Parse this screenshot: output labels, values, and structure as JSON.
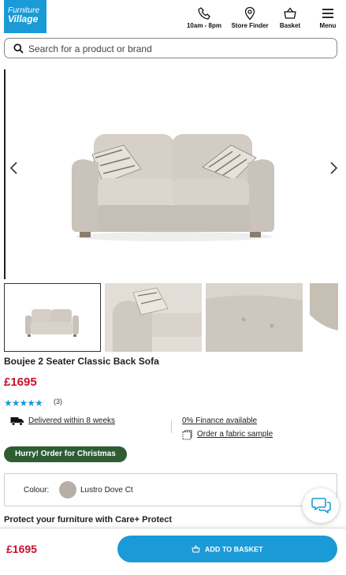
{
  "header": {
    "logo_line1": "Furniture",
    "logo_line2": "Village",
    "phone_label": "10am - 8pm",
    "store_label": "Store Finder",
    "basket_label": "Basket",
    "menu_label": "Menu"
  },
  "search": {
    "placeholder": "Search for a product or brand",
    "value": ""
  },
  "product": {
    "title": "Boujee 2 Seater Classic Back Sofa",
    "price": "£1695",
    "rating": 5,
    "stars": "★★★★★",
    "review_count": "(3)",
    "delivery": "Delivered within 8 weeks",
    "finance": "0% Finance available",
    "fabric_sample": "Order a fabric sample",
    "badge": "Hurry! Order for Christmas",
    "colour_label": "Colour:",
    "colour_name": "Lustro Dove Ct",
    "protect": "Protect your furniture with Care+ Protect"
  },
  "bottom_bar": {
    "price": "£1695",
    "add_to_basket": "ADD TO BASKET"
  },
  "colors": {
    "brand_blue": "#1a9ad6",
    "price_red": "#c8102e",
    "badge_green": "#2e5d34",
    "fabric": "#cbc5bd"
  },
  "icons": [
    "phone-icon",
    "location-pin-icon",
    "basket-icon",
    "menu-icon",
    "search-icon",
    "chevron-left-icon",
    "chevron-right-icon",
    "truck-icon",
    "fabric-swatch-icon",
    "chat-icon"
  ]
}
